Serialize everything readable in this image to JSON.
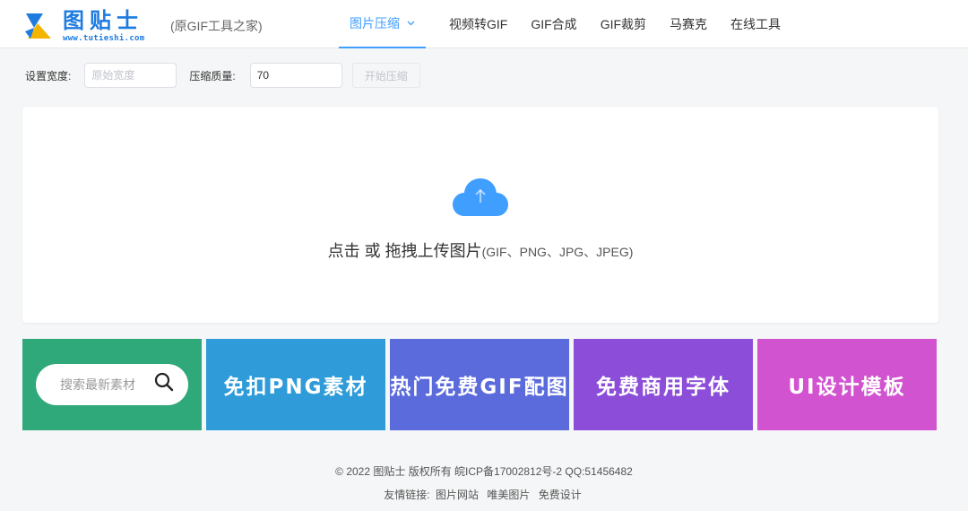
{
  "header": {
    "logo_cn": "图贴士",
    "logo_url": "www.tutieshi.com",
    "slogan": "(原GIF工具之家)",
    "nav": [
      {
        "label": "图片压缩",
        "active": true
      },
      {
        "label": "视频转GIF"
      },
      {
        "label": "GIF合成"
      },
      {
        "label": "GIF裁剪"
      },
      {
        "label": "马赛克"
      },
      {
        "label": "在线工具"
      }
    ],
    "colors": {
      "accent": "#409eff",
      "brand": "#1e7be0"
    }
  },
  "settings": {
    "width_label": "设置宽度:",
    "width_placeholder": "原始宽度",
    "width_value": "",
    "quality_label": "压缩质量:",
    "quality_value": "70",
    "start_button": "开始压缩"
  },
  "upload": {
    "icon": "cloud-upload-icon",
    "main_text": "点击 或 拖拽上传图片",
    "formats": "(GIF、PNG、JPG、JPEG)"
  },
  "tiles": {
    "search_placeholder": "搜索最新素材",
    "items": [
      {
        "label": "免扣PNG素材",
        "color": "#2f9bd8"
      },
      {
        "label": "热门免费GIF配图",
        "color": "#5b6bdb"
      },
      {
        "label": "免费商用字体",
        "color": "#8c4ed8"
      },
      {
        "label": "UI设计模板",
        "color": "#d153d0"
      }
    ],
    "search_tile_color": "#2fa87a"
  },
  "footer": {
    "copyright": "© 2022 图贴士 版权所有 皖ICP备17002812号-2 QQ:51456482",
    "links_label": "友情链接:",
    "links": [
      "图片网站",
      "唯美图片",
      "免费设计"
    ]
  }
}
